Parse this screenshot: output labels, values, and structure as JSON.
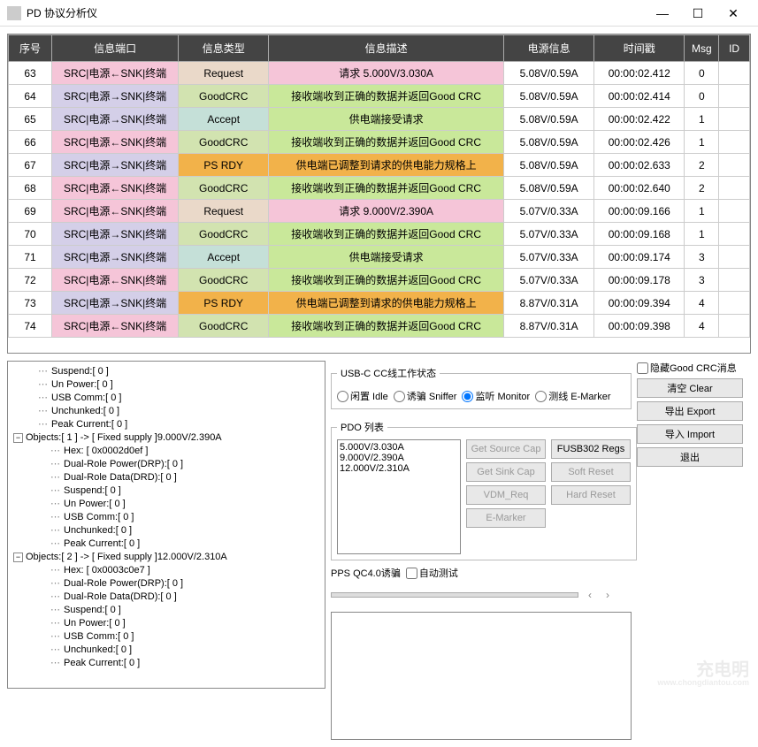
{
  "window": {
    "title": "PD 协议分析仪"
  },
  "table": {
    "headers": [
      "序号",
      "信息端口",
      "信息类型",
      "信息描述",
      "电源信息",
      "时间戳",
      "Msg",
      "ID"
    ],
    "rows": [
      {
        "seq": "63",
        "port": "SRC|电源←SNK|终端",
        "portCls": "port-pink",
        "type": "Request",
        "typeCls": "type-request",
        "desc": "请求 5.000V/3.030A",
        "descCls": "desc-pink",
        "pwr": "5.08V/0.59A",
        "ts": "00:00:02.412",
        "msg": "0",
        "id": ""
      },
      {
        "seq": "64",
        "port": "SRC|电源→SNK|终端",
        "portCls": "port-purple",
        "type": "GoodCRC",
        "typeCls": "type-goodcrc",
        "desc": "接收端收到正确的数据并返回Good CRC",
        "descCls": "desc-green",
        "pwr": "5.08V/0.59A",
        "ts": "00:00:02.414",
        "msg": "0",
        "id": ""
      },
      {
        "seq": "65",
        "port": "SRC|电源→SNK|终端",
        "portCls": "port-purple",
        "type": "Accept",
        "typeCls": "type-accept",
        "desc": "供电端接受请求",
        "descCls": "desc-green",
        "pwr": "5.08V/0.59A",
        "ts": "00:00:02.422",
        "msg": "1",
        "id": ""
      },
      {
        "seq": "66",
        "port": "SRC|电源←SNK|终端",
        "portCls": "port-pink",
        "type": "GoodCRC",
        "typeCls": "type-goodcrc",
        "desc": "接收端收到正确的数据并返回Good CRC",
        "descCls": "desc-green",
        "pwr": "5.08V/0.59A",
        "ts": "00:00:02.426",
        "msg": "1",
        "id": ""
      },
      {
        "seq": "67",
        "port": "SRC|电源→SNK|终端",
        "portCls": "port-purple",
        "type": "PS RDY",
        "typeCls": "type-psrdy",
        "desc": "供电端已调整到请求的供电能力规格上",
        "descCls": "desc-orange",
        "pwr": "5.08V/0.59A",
        "ts": "00:00:02.633",
        "msg": "2",
        "id": ""
      },
      {
        "seq": "68",
        "port": "SRC|电源←SNK|终端",
        "portCls": "port-pink",
        "type": "GoodCRC",
        "typeCls": "type-goodcrc",
        "desc": "接收端收到正确的数据并返回Good CRC",
        "descCls": "desc-green",
        "pwr": "5.08V/0.59A",
        "ts": "00:00:02.640",
        "msg": "2",
        "id": ""
      },
      {
        "seq": "69",
        "port": "SRC|电源←SNK|终端",
        "portCls": "port-pink",
        "type": "Request",
        "typeCls": "type-request",
        "desc": "请求 9.000V/2.390A",
        "descCls": "desc-pink",
        "pwr": "5.07V/0.33A",
        "ts": "00:00:09.166",
        "msg": "1",
        "id": ""
      },
      {
        "seq": "70",
        "port": "SRC|电源→SNK|终端",
        "portCls": "port-purple",
        "type": "GoodCRC",
        "typeCls": "type-goodcrc",
        "desc": "接收端收到正确的数据并返回Good CRC",
        "descCls": "desc-green",
        "pwr": "5.07V/0.33A",
        "ts": "00:00:09.168",
        "msg": "1",
        "id": ""
      },
      {
        "seq": "71",
        "port": "SRC|电源→SNK|终端",
        "portCls": "port-purple",
        "type": "Accept",
        "typeCls": "type-accept",
        "desc": "供电端接受请求",
        "descCls": "desc-green",
        "pwr": "5.07V/0.33A",
        "ts": "00:00:09.174",
        "msg": "3",
        "id": ""
      },
      {
        "seq": "72",
        "port": "SRC|电源←SNK|终端",
        "portCls": "port-pink",
        "type": "GoodCRC",
        "typeCls": "type-goodcrc",
        "desc": "接收端收到正确的数据并返回Good CRC",
        "descCls": "desc-green",
        "pwr": "5.07V/0.33A",
        "ts": "00:00:09.178",
        "msg": "3",
        "id": ""
      },
      {
        "seq": "73",
        "port": "SRC|电源→SNK|终端",
        "portCls": "port-purple",
        "type": "PS RDY",
        "typeCls": "type-psrdy",
        "desc": "供电端已调整到请求的供电能力规格上",
        "descCls": "desc-orange",
        "pwr": "8.87V/0.31A",
        "ts": "00:00:09.394",
        "msg": "4",
        "id": ""
      },
      {
        "seq": "74",
        "port": "SRC|电源←SNK|终端",
        "portCls": "port-pink",
        "type": "GoodCRC",
        "typeCls": "type-goodcrc",
        "desc": "接收端收到正确的数据并返回Good CRC",
        "descCls": "desc-green",
        "pwr": "8.87V/0.31A",
        "ts": "00:00:09.398",
        "msg": "4",
        "id": ""
      }
    ]
  },
  "tree": [
    {
      "t": "Suspend:[ 0 ]"
    },
    {
      "t": "Un Power:[ 0 ]"
    },
    {
      "t": "USB Comm:[ 0 ]"
    },
    {
      "t": "Unchunked:[ 0 ]"
    },
    {
      "t": "Peak Current:[ 0 ]"
    },
    {
      "t": "Objects:[ 1 ] -> [ Fixed supply ]9.000V/2.390A",
      "exp": true,
      "children": [
        {
          "t": "Hex: [ 0x0002d0ef ]"
        },
        {
          "t": "Dual-Role Power(DRP):[ 0 ]"
        },
        {
          "t": "Dual-Role Data(DRD):[ 0 ]"
        },
        {
          "t": "Suspend:[ 0 ]"
        },
        {
          "t": "Un Power:[ 0 ]"
        },
        {
          "t": "USB Comm:[ 0 ]"
        },
        {
          "t": "Unchunked:[ 0 ]"
        },
        {
          "t": "Peak Current:[ 0 ]"
        }
      ]
    },
    {
      "t": "Objects:[ 2 ] -> [ Fixed supply ]12.000V/2.310A",
      "exp": true,
      "children": [
        {
          "t": "Hex: [ 0x0003c0e7 ]"
        },
        {
          "t": "Dual-Role Power(DRP):[ 0 ]"
        },
        {
          "t": "Dual-Role Data(DRD):[ 0 ]"
        },
        {
          "t": "Suspend:[ 0 ]"
        },
        {
          "t": "Un Power:[ 0 ]"
        },
        {
          "t": "USB Comm:[ 0 ]"
        },
        {
          "t": "Unchunked:[ 0 ]"
        },
        {
          "t": "Peak Current:[ 0 ]"
        }
      ]
    }
  ],
  "ccgroup": {
    "legend": "USB-C CC线工作状态",
    "radios": [
      {
        "label": "闲置 Idle",
        "checked": false
      },
      {
        "label": "诱骗 Sniffer",
        "checked": false
      },
      {
        "label": "监听 Monitor",
        "checked": true
      },
      {
        "label": "测线 E-Marker",
        "checked": false
      }
    ]
  },
  "pdo": {
    "legend": "PDO 列表",
    "items": [
      "5.000V/3.030A",
      "9.000V/2.390A",
      "12.000V/2.310A"
    ],
    "btns1": [
      "Get Source Cap",
      "Get Sink Cap",
      "VDM_Req",
      "E-Marker"
    ],
    "btns2": [
      "FUSB302 Regs",
      "Soft Reset",
      "Hard Reset"
    ]
  },
  "pps": {
    "label": "PPS QC4.0诱骗",
    "autochk": "自动测试"
  },
  "right": {
    "hidechk": "隐藏Good CRC消息",
    "btns": [
      "清空 Clear",
      "导出 Export",
      "导入 Import",
      "退出"
    ]
  },
  "watermark": {
    "main": "充电明",
    "sub": "www.chongdiantou.com"
  }
}
